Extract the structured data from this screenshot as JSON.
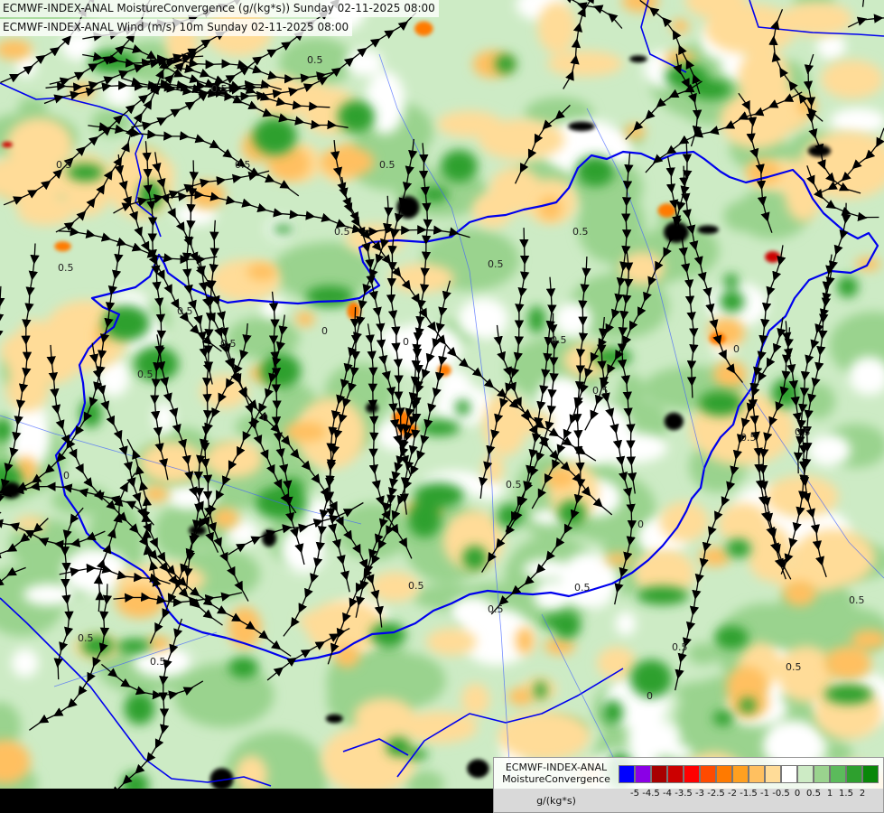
{
  "titles": {
    "line1": "ECMWF-INDEX-ANAL MoistureConvergence (g/(kg*s)) Sunday 02-11-2025 08:00",
    "line2": "ECMWF-INDEX-ANAL Wind (m/s) 10m Sunday 02-11-2025 08:00"
  },
  "legend": {
    "title": "ECMWF-INDEX-ANAL MoistureConvergence",
    "unit": "g/(kg*s)",
    "colors": [
      "#0000ff",
      "#8a00e6",
      "#a80000",
      "#cc0000",
      "#ff0000",
      "#ff4a00",
      "#ff7a00",
      "#ffa020",
      "#ffc060",
      "#ffdc98",
      "#ffffff",
      "#cdebc5",
      "#9ad38e",
      "#5bbb5b",
      "#2ea02e",
      "#098709"
    ],
    "tick_labels": [
      "-5",
      "-4.5",
      "-4",
      "-3.5",
      "-3",
      "-2.5",
      "-2",
      "-1.5",
      "-1",
      "-0.5",
      "0",
      "0.5",
      "1",
      "1.5",
      "2"
    ]
  },
  "map": {
    "field_colors": {
      "negative_weak": "#ffdc98",
      "negative_mid": "#ffc060",
      "negative_strong": "#ff7a00",
      "negative_extreme": "#cc0000",
      "neutral": "#ffffff",
      "positive_weak": "#cdebc5",
      "positive_mid": "#9ad38e",
      "positive_strong": "#2ea02e",
      "positive_extreme": "#000000"
    },
    "border_color": "#0000ee",
    "streamline_color": "#000000",
    "contour_labels": [
      "0.5",
      "0.5",
      "0.5",
      "0.5",
      "0.5",
      "0.5",
      "0.5",
      "0.5",
      "0.5",
      "0.5",
      "0.5",
      "0.5",
      "0.5",
      "0.5",
      "0.5",
      "0.5",
      "0.5",
      "0.5",
      "0.5",
      "0.5",
      "0.5",
      "0.5",
      "0.5",
      "0.5",
      "0.5",
      "0",
      "0",
      "0",
      "0",
      "0",
      "0",
      "0"
    ]
  }
}
